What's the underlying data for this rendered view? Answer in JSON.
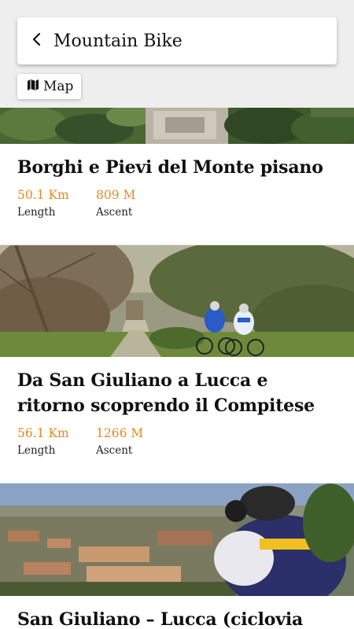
{
  "header": {
    "title": "Mountain Bike",
    "back_icon": "chevron-left-icon",
    "map_button_label": "Map",
    "map_icon": "map-icon"
  },
  "colors": {
    "accent": "#e8871e",
    "text": "#111111",
    "background": "#eeeeee"
  },
  "routes": [
    {
      "title": "Borghi e Pievi del Monte pisano",
      "length_value": "50.1 Km",
      "length_label": "Length",
      "ascent_value": "809 M",
      "ascent_label": "Ascent"
    },
    {
      "title": "Da San Giuliano a Lucca e ritorno scoprendo il Compitese",
      "length_value": "56.1 Km",
      "length_label": "Length",
      "ascent_value": "1266 M",
      "ascent_label": "Ascent"
    },
    {
      "title": "San Giuliano – Lucca (ciclovia"
    }
  ]
}
